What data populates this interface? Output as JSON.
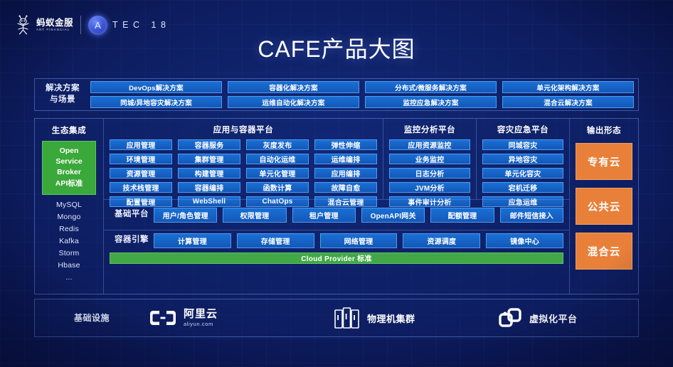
{
  "header": {
    "ant_logo_cn": "蚂蚁金服",
    "ant_logo_en": "ANT FINANCIAL",
    "atec_badge": "A",
    "atec_text": "TEC 18"
  },
  "title": "CAFE产品大图",
  "solutions": {
    "label": "解决方案\n与场景",
    "label_line1": "解决方案",
    "label_line2": "与场景",
    "row1": [
      "DevOps解决方案",
      "容器化解决方案",
      "分布式/微服务解决方案",
      "单元化架构解决方案"
    ],
    "row2": [
      "同城/异地容灾解决方案",
      "运维自动化解决方案",
      "监控应急解决方案",
      "混合云解决方案"
    ]
  },
  "ecosystem": {
    "title": "生态集成",
    "osb": "Open\nService\nBroker\nAPI标准",
    "osb_lines": [
      "Open",
      "Service",
      "Broker",
      "API标准"
    ],
    "items": [
      "MySQL",
      "Mongo",
      "Redis",
      "Kafka",
      "Storm",
      "Hbase",
      "..."
    ]
  },
  "app_container_platform": {
    "title": "应用与容器平台",
    "tiles": [
      "应用管理",
      "容器服务",
      "灰度发布",
      "弹性伸缩",
      "环境管理",
      "集群管理",
      "自动化运维",
      "运维编排",
      "资源管理",
      "构建管理",
      "单元化管理",
      "应用编排",
      "技术栈管理",
      "容器编排",
      "函数计算",
      "故障自愈",
      "配置管理",
      "WebShell",
      "ChatOps",
      "混合云管理"
    ]
  },
  "monitor_platform": {
    "title": "监控分析平台",
    "tiles": [
      "应用资源监控",
      "业务监控",
      "日志分析",
      "JVM分析",
      "事件审计分析"
    ]
  },
  "dr_platform": {
    "title": "容灾应急平台",
    "tiles": [
      "同城容灾",
      "异地容灾",
      "单元化容灾",
      "宕机迁移",
      "应急运维"
    ]
  },
  "base_platform": {
    "label": "基础平台",
    "tiles": [
      "用户/角色管理",
      "权限管理",
      "租户管理",
      "OpenAPI网关",
      "配额管理",
      "邮件短信接入"
    ]
  },
  "container_engine": {
    "label": "容器引擎",
    "tiles": [
      "计算管理",
      "存储管理",
      "网络管理",
      "资源调度",
      "镜像中心"
    ],
    "cloud_provider": "Cloud Provider 标准"
  },
  "output": {
    "title": "输出形态",
    "boxes": [
      "专有云",
      "公共云",
      "混合云"
    ]
  },
  "infrastructure": {
    "label": "基础设施",
    "items": [
      {
        "name": "阿里云",
        "sub": "aliyun.com",
        "icon": "aliyun-logo-icon"
      },
      {
        "name": "物理机集群",
        "icon": "server-rack-icon"
      },
      {
        "name": "虚拟化平台",
        "icon": "virtualization-icon"
      }
    ]
  },
  "colors": {
    "tile_blue": "#1a6fd4",
    "tile_border": "#4f9cf0",
    "green": "#3aa83a",
    "cloud_provider_green": "#41a845",
    "orange": "#e8803a",
    "background": "#0e1f64"
  }
}
